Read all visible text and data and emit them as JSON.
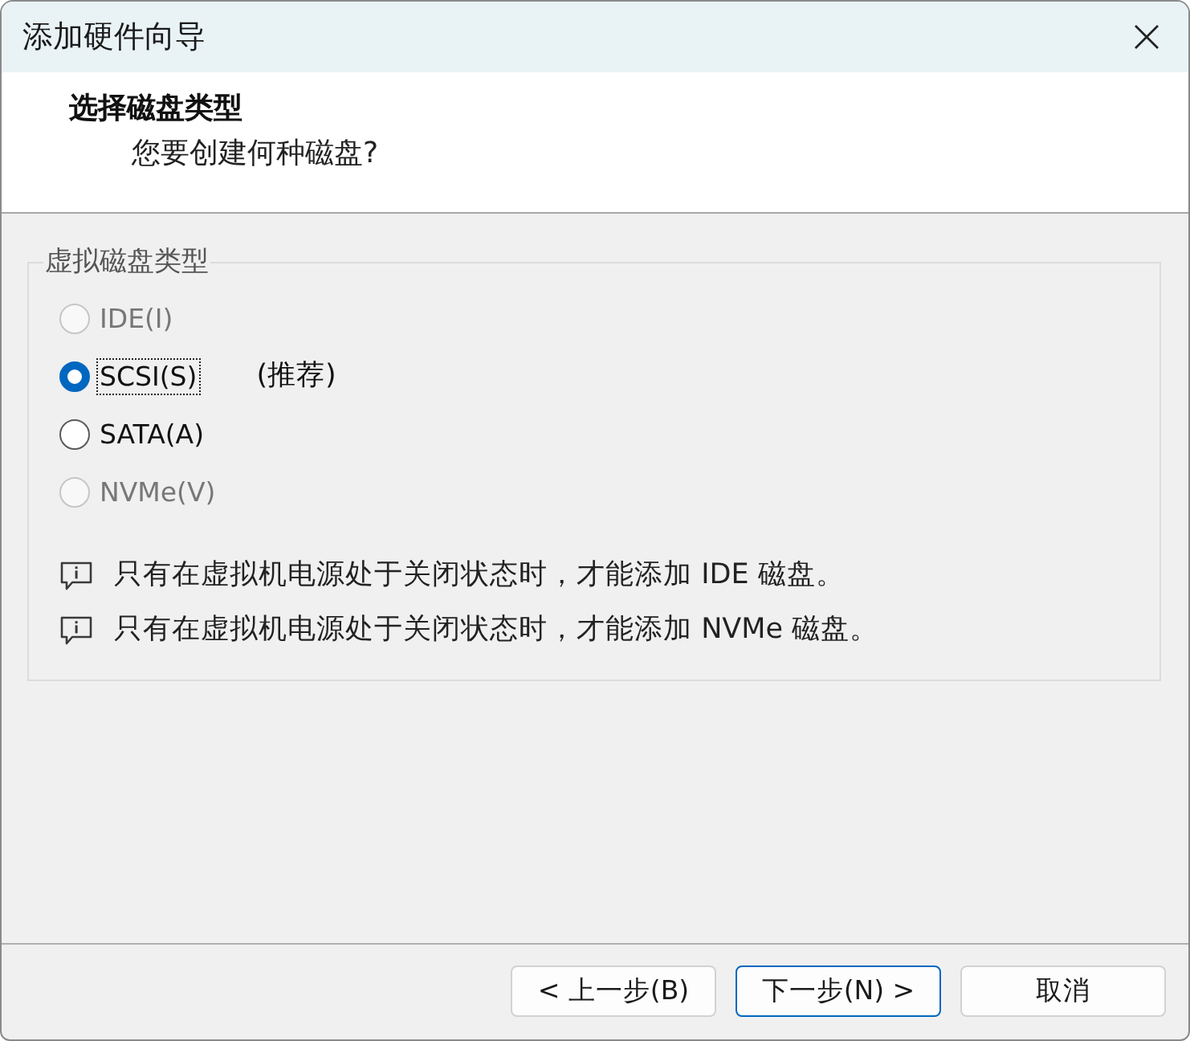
{
  "window": {
    "title": "添加硬件向导"
  },
  "header": {
    "title": "选择磁盘类型",
    "subtitle": "您要创建何种磁盘?"
  },
  "disk_type_group": {
    "legend": "虚拟磁盘类型",
    "options": [
      {
        "label": "IDE(I)",
        "selected": false,
        "disabled": true,
        "focused": false
      },
      {
        "label": "SCSI(S)",
        "selected": true,
        "disabled": false,
        "focused": true,
        "note": "(推荐)"
      },
      {
        "label": "SATA(A)",
        "selected": false,
        "disabled": false,
        "focused": false
      },
      {
        "label": "NVMe(V)",
        "selected": false,
        "disabled": true,
        "focused": false
      }
    ]
  },
  "info_messages": [
    "只有在虚拟机电源处于关闭状态时，才能添加 IDE 磁盘。",
    "只有在虚拟机电源处于关闭状态时，才能添加 NVMe 磁盘。"
  ],
  "buttons": [
    {
      "label": "< 上一步(B)",
      "focused": false
    },
    {
      "label": "下一步(N) >",
      "focused": true
    },
    {
      "label": "取消",
      "focused": false
    }
  ]
}
